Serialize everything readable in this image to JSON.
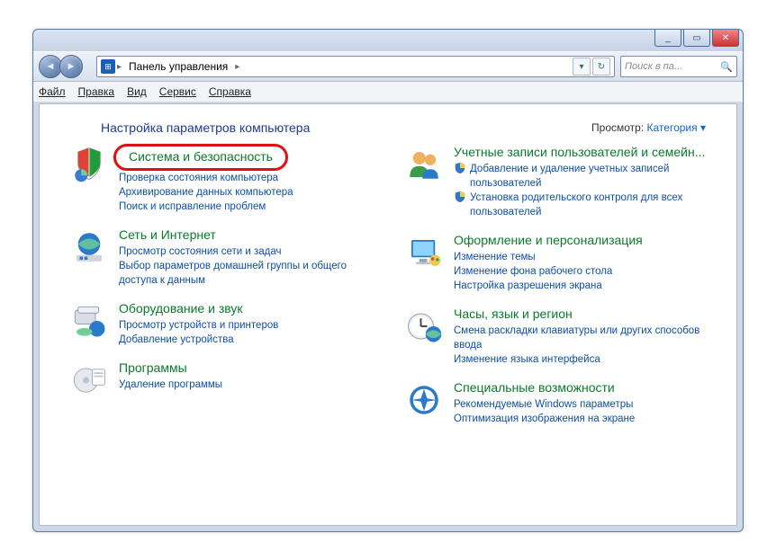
{
  "window": {
    "min_label": "_",
    "max_label": "▭",
    "close_label": "✕"
  },
  "nav": {
    "back_glyph": "◄",
    "fwd_glyph": "►",
    "crumb_root": "Панель управления",
    "crumb_sep": "▸",
    "dropdown_glyph": "▾",
    "refresh_glyph": "↻"
  },
  "search": {
    "placeholder": "Поиск в па...",
    "icon": "🔍"
  },
  "menus": {
    "file": "Файл",
    "edit": "Правка",
    "view": "Вид",
    "tools": "Сервис",
    "help": "Справка"
  },
  "heading": "Настройка параметров компьютера",
  "view_label": "Просмотр:",
  "view_value": "Категория",
  "view_arrow": "▾",
  "categories": {
    "system": {
      "title": "Система и безопасность",
      "subs": [
        "Проверка состояния компьютера",
        "Архивирование данных компьютера",
        "Поиск и исправление проблем"
      ]
    },
    "network": {
      "title": "Сеть и Интернет",
      "subs": [
        "Просмотр состояния сети и задач",
        "Выбор параметров домашней группы и общего доступа к данным"
      ]
    },
    "hardware": {
      "title": "Оборудование и звук",
      "subs": [
        "Просмотр устройств и принтеров",
        "Добавление устройства"
      ]
    },
    "programs": {
      "title": "Программы",
      "subs": [
        "Удаление программы"
      ]
    },
    "users": {
      "title": "Учетные записи пользователей и семейн...",
      "subs": [
        "Добавление и удаление учетных записей пользователей",
        "Установка родительского контроля для всех пользователей"
      ]
    },
    "appearance": {
      "title": "Оформление и персонализация",
      "subs": [
        "Изменение темы",
        "Изменение фона рабочего стола",
        "Настройка разрешения экрана"
      ]
    },
    "clock": {
      "title": "Часы, язык и регион",
      "subs": [
        "Смена раскладки клавиатуры или других способов ввода",
        "Изменение языка интерфейса"
      ]
    },
    "ease": {
      "title": "Специальные возможности",
      "subs": [
        "Рекомендуемые Windows параметры",
        "Оптимизация изображения на экране"
      ]
    }
  }
}
